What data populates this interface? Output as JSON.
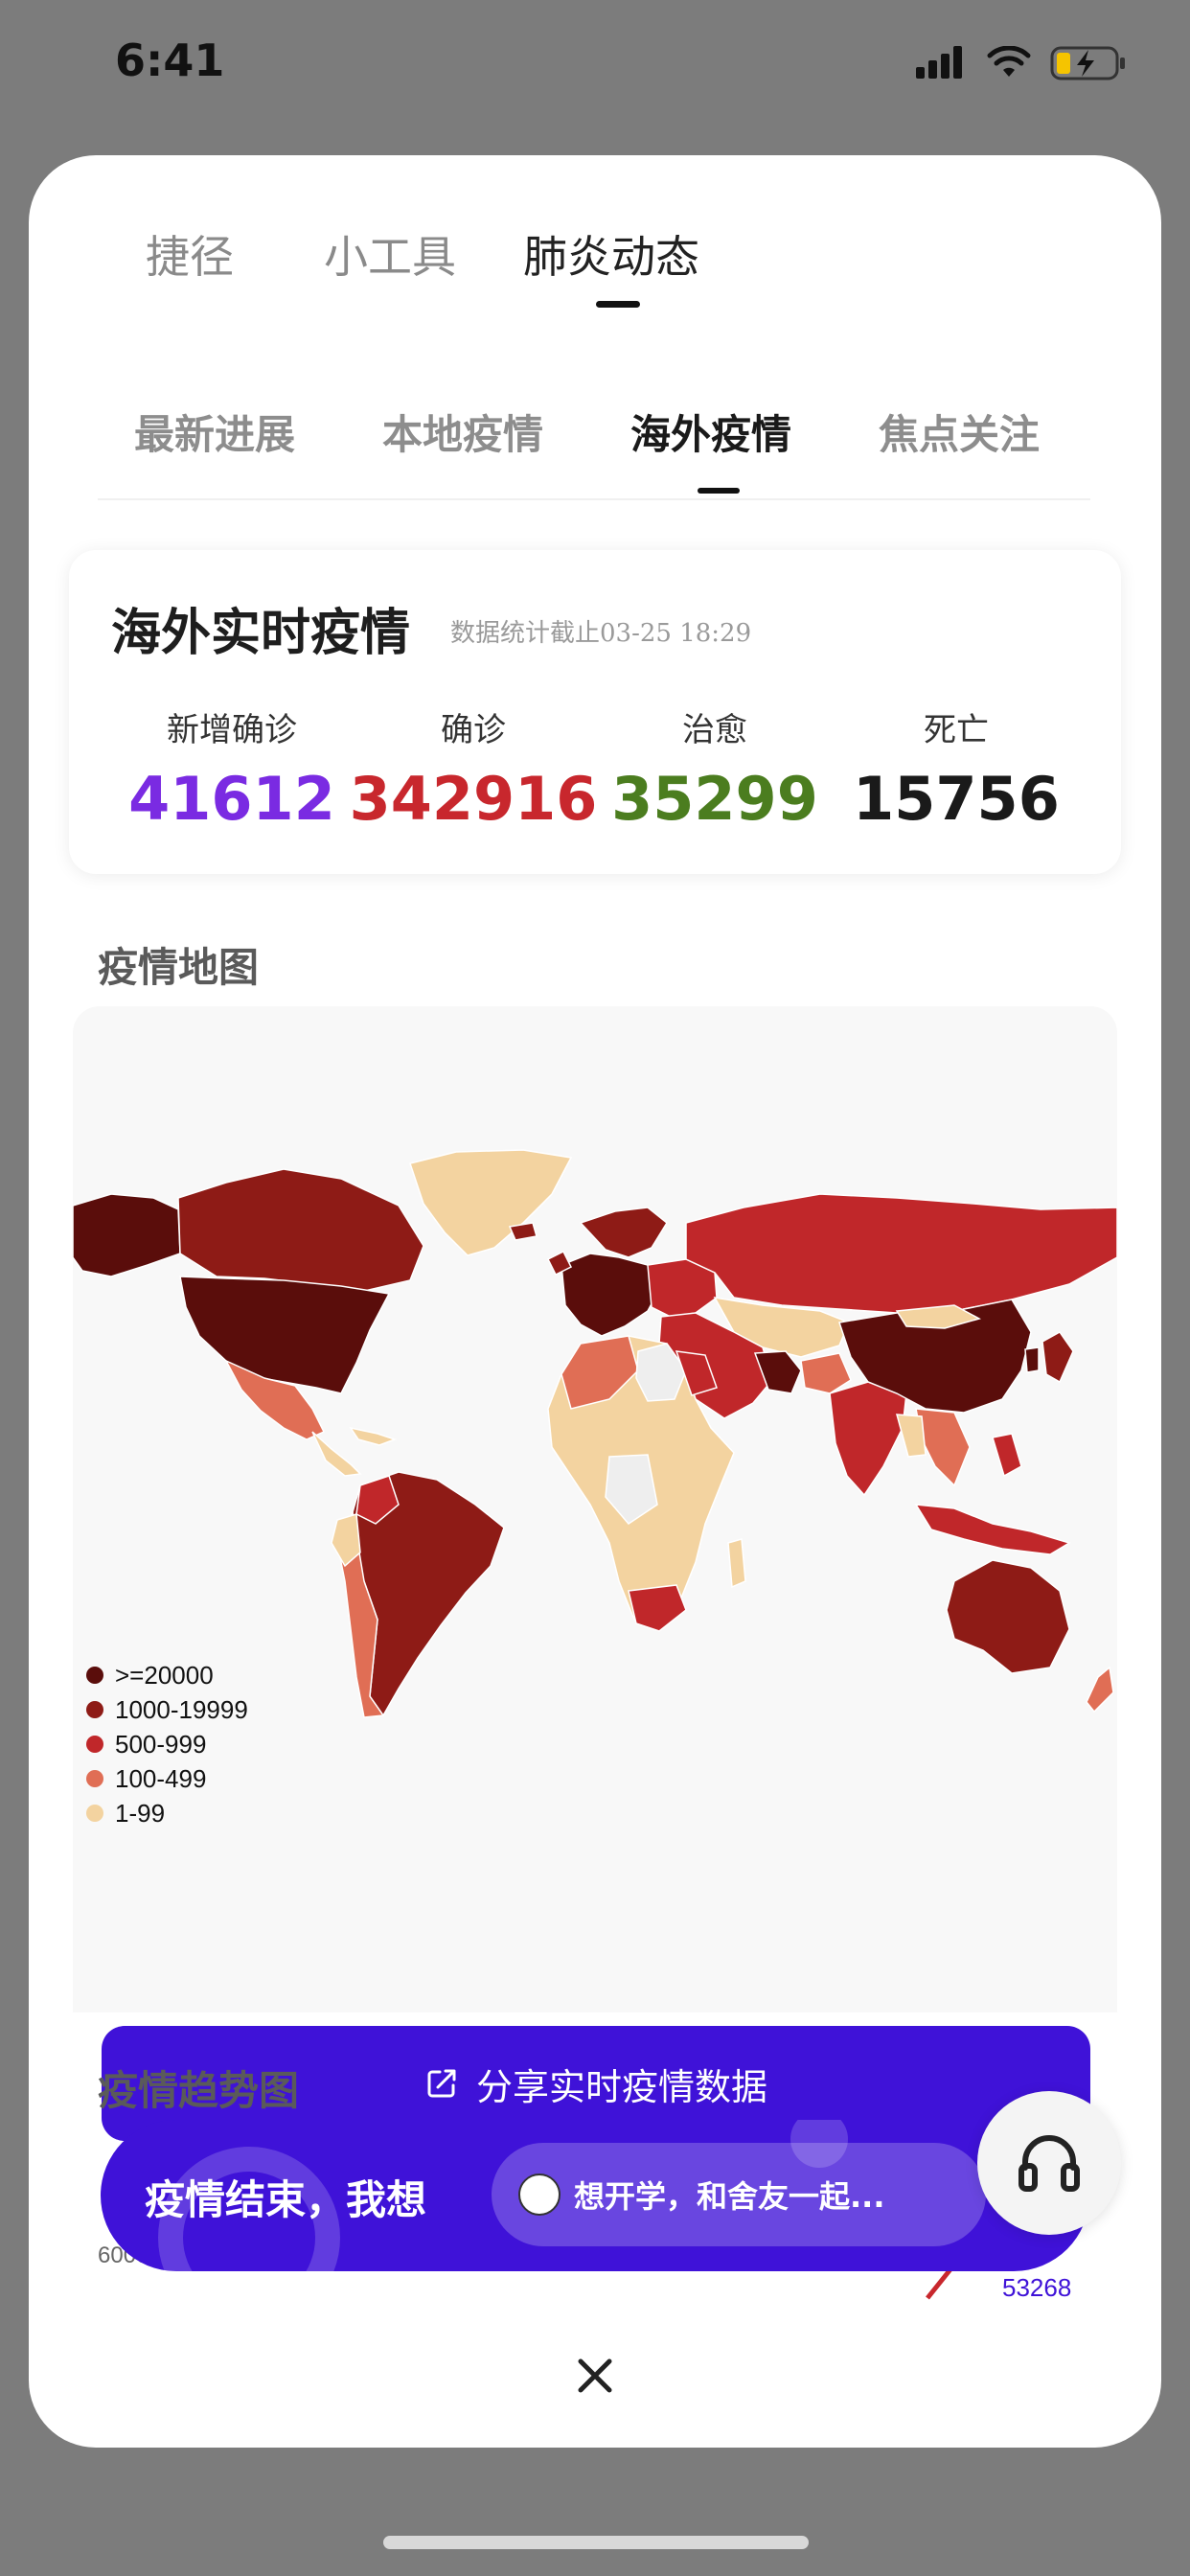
{
  "status_bar": {
    "time": "6:41"
  },
  "top_tabs": [
    {
      "label": "捷径",
      "active": false
    },
    {
      "label": "小工具",
      "active": false
    },
    {
      "label": "肺炎动态",
      "active": true
    }
  ],
  "sub_tabs": [
    {
      "label": "最新进展",
      "active": false
    },
    {
      "label": "本地疫情",
      "active": false
    },
    {
      "label": "海外疫情",
      "active": true
    },
    {
      "label": "焦点关注",
      "active": false
    }
  ],
  "stats": {
    "title": "海外实时疫情",
    "note": "数据统计截止03-25 18:29",
    "items": [
      {
        "label": "新增确诊",
        "value": "41612",
        "color": "#7a2be2"
      },
      {
        "label": "确诊",
        "value": "342916",
        "color": "#c8272d"
      },
      {
        "label": "治愈",
        "value": "35299",
        "color": "#4b7d1f"
      },
      {
        "label": "死亡",
        "value": "15756",
        "color": "#1a1a1a"
      }
    ]
  },
  "map": {
    "title": "疫情地图",
    "legend": [
      {
        "label": ">=20000",
        "color": "#5a0d0b"
      },
      {
        "label": "1000-19999",
        "color": "#8e1b16"
      },
      {
        "label": "500-999",
        "color": "#c0272a"
      },
      {
        "label": "100-499",
        "color": "#e06e55"
      },
      {
        "label": "1-99",
        "color": "#f3d3a0"
      }
    ],
    "share_label": "分享实时疫情数据"
  },
  "trend": {
    "title": "疫情趋势图",
    "axis_label": "60000",
    "value_label": "53268"
  },
  "banner": {
    "text": "疫情结束，我想",
    "pill_text": "想开学，和舍友一起..."
  }
}
